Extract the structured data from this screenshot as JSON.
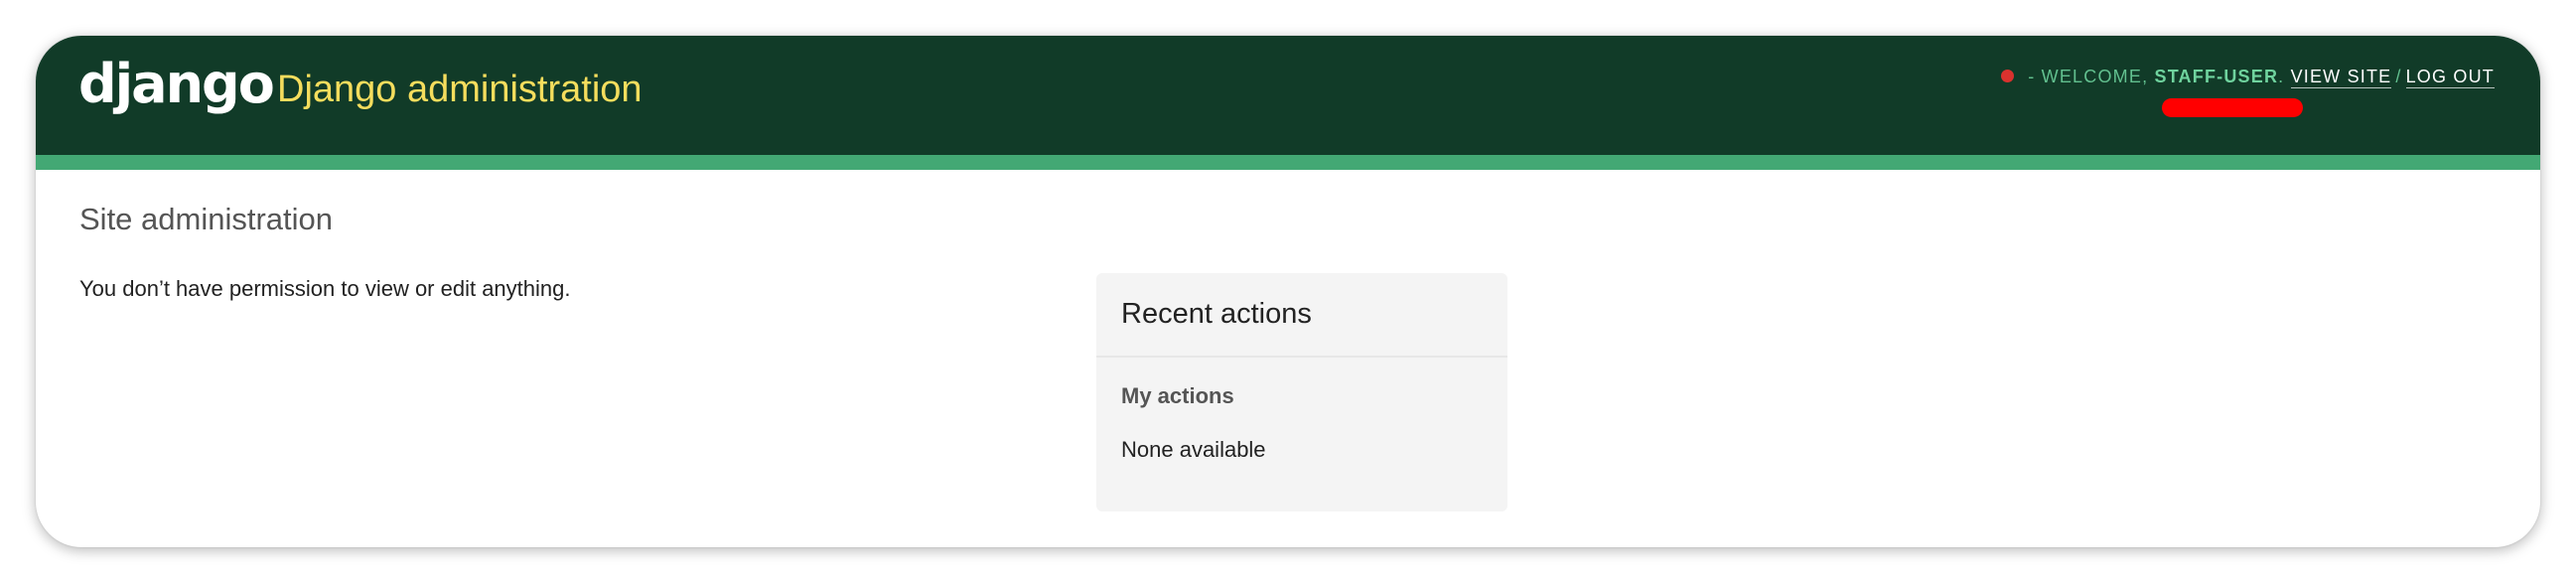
{
  "header": {
    "logo_text": "django",
    "site_name": "Django administration",
    "user_tools": {
      "status_color": "#d9322e",
      "welcome_text": "- Welcome,",
      "username": "staff-user",
      "separator": ".",
      "view_site_label": "View site",
      "slash": "/",
      "logout_label": "Log out"
    }
  },
  "content": {
    "page_title": "Site administration",
    "permission_message": "You don’t have permission to view or edit anything."
  },
  "recent_actions": {
    "title": "Recent actions",
    "subtitle": "My actions",
    "empty_text": "None available"
  },
  "colors": {
    "header_bg": "#113b28",
    "header_stripe": "#43a874",
    "site_name": "#f5dd5d",
    "redaction_mark": "#ff0000",
    "module_bg": "#f4f4f4"
  }
}
